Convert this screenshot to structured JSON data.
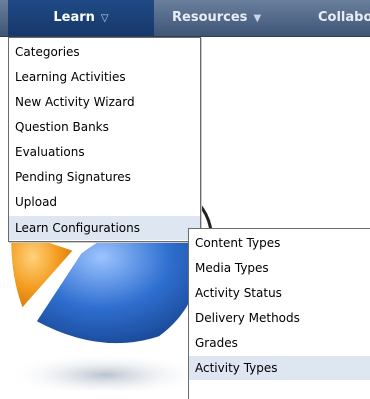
{
  "nav": {
    "items": [
      {
        "label": "Learn",
        "icon": "chevron-down-icon",
        "active": true
      },
      {
        "label": "Resources",
        "icon": "chevron-down-icon",
        "active": false
      },
      {
        "label": "Collabor",
        "active": false
      }
    ]
  },
  "learn_menu": {
    "items": [
      {
        "label": "Categories"
      },
      {
        "label": "Learning Activities"
      },
      {
        "label": "New Activity Wizard"
      },
      {
        "label": "Question Banks"
      },
      {
        "label": "Evaluations"
      },
      {
        "label": "Pending Signatures"
      },
      {
        "label": "Upload"
      },
      {
        "label": "Learn Configurations",
        "highlighted": true
      }
    ]
  },
  "config_submenu": {
    "items": [
      {
        "label": "Content Types"
      },
      {
        "label": "Media Types"
      },
      {
        "label": "Activity Status"
      },
      {
        "label": "Delivery Methods"
      },
      {
        "label": "Grades"
      },
      {
        "label": "Activity Types",
        "highlighted": true
      }
    ]
  },
  "colors": {
    "nav_bar": "#4f6688",
    "nav_active": "#1c4380",
    "menu_highlight": "#dde6f1",
    "logo_orange": "#f39a1e",
    "logo_blue": "#1e5bb8"
  }
}
